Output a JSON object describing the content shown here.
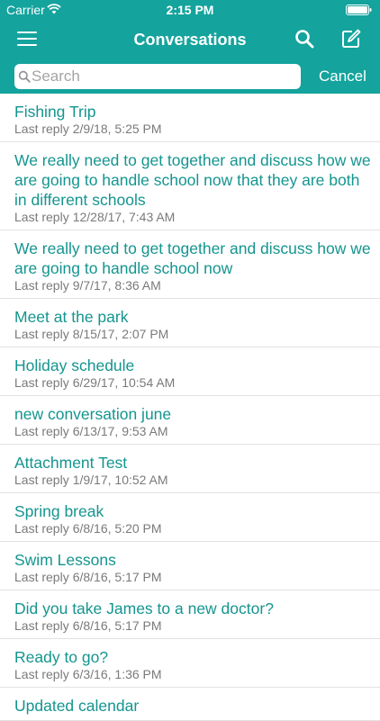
{
  "status_bar": {
    "carrier": "Carrier",
    "time": "2:15 PM"
  },
  "nav": {
    "title": "Conversations"
  },
  "search": {
    "placeholder": "Search",
    "value": "",
    "cancel_label": "Cancel"
  },
  "colors": {
    "accent": "#14a39d",
    "link_text": "#14958f",
    "meta_text": "#7a7a7a"
  },
  "conversations": [
    {
      "title": "Fishing Trip",
      "reply_label": "Last reply",
      "reply_time": "2/9/18, 5:25 PM"
    },
    {
      "title": "We really need to get together and discuss how we are going to handle school now that they are both in different schools",
      "reply_label": "Last reply",
      "reply_time": "12/28/17, 7:43 AM"
    },
    {
      "title": "We really need to get together and discuss how we are going to handle school now",
      "reply_label": "Last reply",
      "reply_time": "9/7/17, 8:36 AM"
    },
    {
      "title": "Meet at the park",
      "reply_label": "Last reply",
      "reply_time": "8/15/17, 2:07 PM"
    },
    {
      "title": "Holiday schedule",
      "reply_label": "Last reply",
      "reply_time": "6/29/17, 10:54 AM"
    },
    {
      "title": "new conversation june",
      "reply_label": "Last reply",
      "reply_time": "6/13/17, 9:53 AM"
    },
    {
      "title": "Attachment Test",
      "reply_label": "Last reply",
      "reply_time": "1/9/17, 10:52 AM"
    },
    {
      "title": "Spring break",
      "reply_label": "Last reply",
      "reply_time": "6/8/16, 5:20 PM"
    },
    {
      "title": "Swim Lessons",
      "reply_label": "Last reply",
      "reply_time": "6/8/16, 5:17 PM"
    },
    {
      "title": "Did you take James to a new doctor?",
      "reply_label": "Last reply",
      "reply_time": "6/8/16, 5:17 PM"
    },
    {
      "title": "Ready to go?",
      "reply_label": "Last reply",
      "reply_time": "6/3/16, 1:36 PM"
    },
    {
      "title": "Updated calendar",
      "reply_label": "",
      "reply_time": ""
    }
  ]
}
